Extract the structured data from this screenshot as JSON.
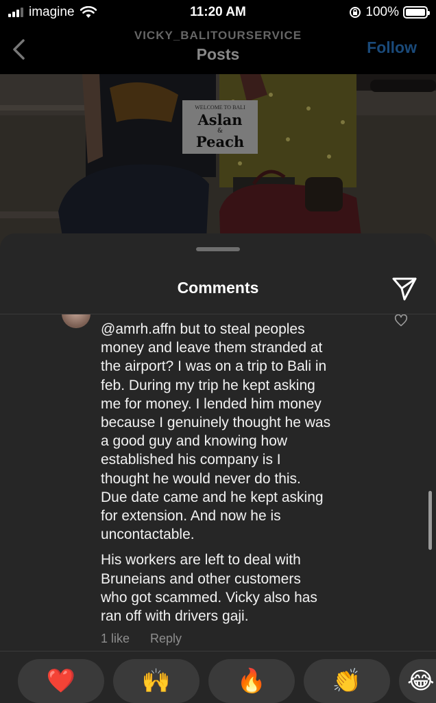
{
  "status_bar": {
    "carrier": "imagine",
    "time": "11:20 AM",
    "battery": "100%"
  },
  "header": {
    "account_name": "VICKY_BALITOURSERVICE",
    "title": "Posts",
    "follow_label": "Follow"
  },
  "photo": {
    "sign_top": "WELCOME TO BALI",
    "sign_line1": "Aslan",
    "sign_amp": "&",
    "sign_line2": "Peach"
  },
  "comments_sheet": {
    "title": "Comments",
    "comment": {
      "paragraph1_lines": [
        "@amrh.affn but to steal peoples",
        "money and leave them stranded at",
        "the airport?  I was on a trip to Bali in",
        "feb. During my trip he kept asking",
        "me for money. I lended him money",
        "because I genuinely thought he was",
        "a good guy and knowing  how",
        "established his company is I",
        "thought he would never do this.",
        "Due date came and he kept asking",
        "for extension. And now he is",
        "uncontactable."
      ],
      "paragraph2_lines": [
        "His workers are left to deal with",
        "Bruneians and other customers",
        "who got scammed. Vicky also has",
        "ran off with drivers gaji."
      ],
      "likes": "1 like",
      "reply_label": "Reply"
    },
    "emoji_reactions": [
      "❤️",
      "🙌",
      "🔥",
      "👏",
      "😂"
    ]
  }
}
